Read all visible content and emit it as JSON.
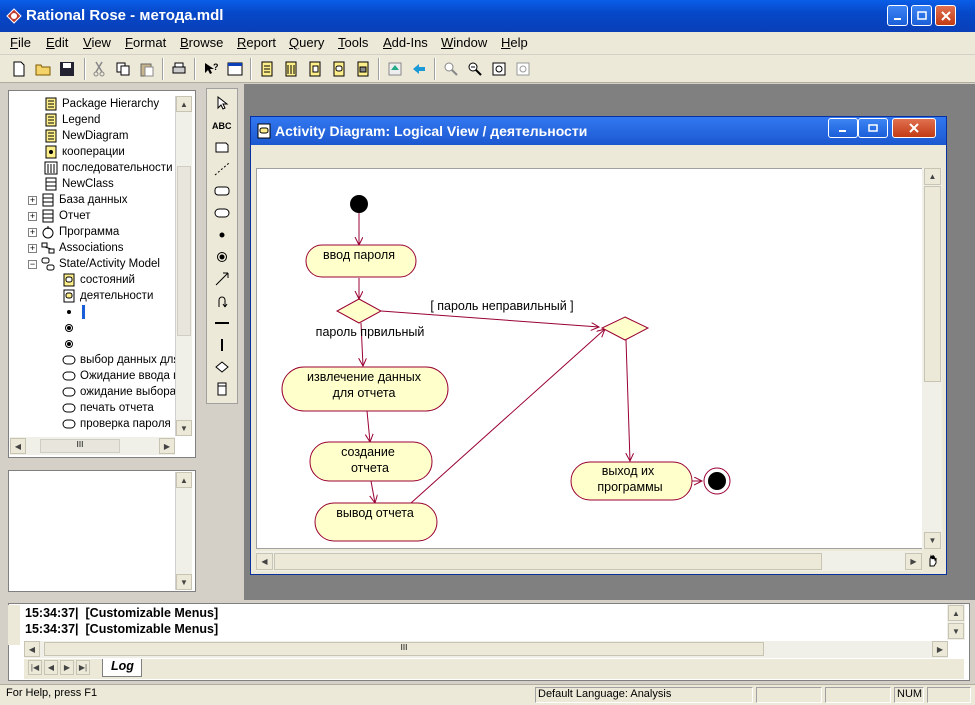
{
  "window": {
    "title": "Rational Rose - метода.mdl"
  },
  "menu": [
    "File",
    "Edit",
    "View",
    "Format",
    "Browse",
    "Report",
    "Query",
    "Tools",
    "Add-Ins",
    "Window",
    "Help"
  ],
  "browser": {
    "items": [
      {
        "label": "Package Hierarchy",
        "icon": "diagram-icon"
      },
      {
        "label": "Legend",
        "icon": "diagram-icon"
      },
      {
        "label": "NewDiagram",
        "icon": "diagram-icon"
      },
      {
        "label": "кооперации",
        "icon": "collaboration-diagram-icon"
      },
      {
        "label": "последовательности",
        "icon": "sequence-diagram-icon"
      },
      {
        "label": "NewClass",
        "icon": "class-icon"
      },
      {
        "label": "База данных",
        "icon": "class-icon"
      },
      {
        "label": "Отчет",
        "icon": "class-icon"
      },
      {
        "label": "Программа",
        "icon": "interface-icon"
      },
      {
        "label": "Associations",
        "icon": "associations-icon"
      },
      {
        "label": "State/Activity Model",
        "icon": "state-model-icon"
      },
      {
        "label": "состояний",
        "icon": "statechart-diagram-icon"
      },
      {
        "label": "деятельности",
        "icon": "activity-diagram-icon"
      },
      {
        "label": "",
        "icon": "start-state-icon"
      },
      {
        "label": "",
        "icon": "end-state-icon"
      },
      {
        "label": "",
        "icon": "end-state-icon"
      },
      {
        "label": "выбор данных для",
        "icon": "activity-icon"
      },
      {
        "label": "Ожидание ввода п",
        "icon": "activity-icon"
      },
      {
        "label": "ожидание выбора",
        "icon": "activity-icon"
      },
      {
        "label": "печать отчета",
        "icon": "activity-icon"
      },
      {
        "label": "проверка пароля",
        "icon": "activity-icon"
      }
    ]
  },
  "diagram": {
    "title": "Activity Diagram: Logical View / деятельности",
    "activities": {
      "a1": "ввод пароля",
      "a2_line1": "извлечение данных",
      "a2_line2": "для отчета",
      "a3_line1": "создание",
      "a3_line2": "отчета",
      "a4": "вывод отчета",
      "a5_line1": "выход их",
      "a5_line2": "программы"
    },
    "guards": {
      "wrong": "[ пароль неправильный ]",
      "right": "пароль првильный"
    }
  },
  "log": {
    "lines": [
      {
        "time": "15:34:37|",
        "text": "[Customizable Menus]"
      },
      {
        "time": "15:34:37|",
        "text": "[Customizable Menus]"
      }
    ],
    "tab": "Log"
  },
  "status": {
    "help": "For Help, press F1",
    "language": "Default Language: Analysis",
    "num": "NUM"
  },
  "colors": {
    "activity_fill": "#ffffcc",
    "activity_stroke": "#990033",
    "titlebar": "#0648c8"
  }
}
